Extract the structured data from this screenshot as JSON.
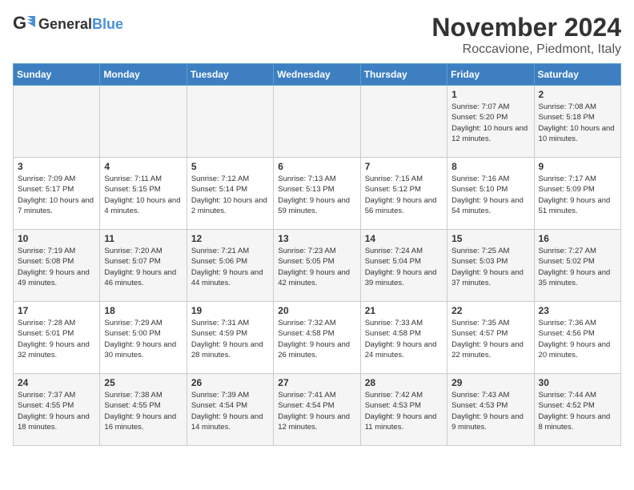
{
  "logo": {
    "text_general": "General",
    "text_blue": "Blue"
  },
  "calendar": {
    "title": "November 2024",
    "subtitle": "Roccavione, Piedmont, Italy"
  },
  "days_of_week": [
    "Sunday",
    "Monday",
    "Tuesday",
    "Wednesday",
    "Thursday",
    "Friday",
    "Saturday"
  ],
  "weeks": [
    [
      {
        "day": "",
        "info": ""
      },
      {
        "day": "",
        "info": ""
      },
      {
        "day": "",
        "info": ""
      },
      {
        "day": "",
        "info": ""
      },
      {
        "day": "",
        "info": ""
      },
      {
        "day": "1",
        "info": "Sunrise: 7:07 AM\nSunset: 5:20 PM\nDaylight: 10 hours and 12 minutes."
      },
      {
        "day": "2",
        "info": "Sunrise: 7:08 AM\nSunset: 5:18 PM\nDaylight: 10 hours and 10 minutes."
      }
    ],
    [
      {
        "day": "3",
        "info": "Sunrise: 7:09 AM\nSunset: 5:17 PM\nDaylight: 10 hours and 7 minutes."
      },
      {
        "day": "4",
        "info": "Sunrise: 7:11 AM\nSunset: 5:15 PM\nDaylight: 10 hours and 4 minutes."
      },
      {
        "day": "5",
        "info": "Sunrise: 7:12 AM\nSunset: 5:14 PM\nDaylight: 10 hours and 2 minutes."
      },
      {
        "day": "6",
        "info": "Sunrise: 7:13 AM\nSunset: 5:13 PM\nDaylight: 9 hours and 59 minutes."
      },
      {
        "day": "7",
        "info": "Sunrise: 7:15 AM\nSunset: 5:12 PM\nDaylight: 9 hours and 56 minutes."
      },
      {
        "day": "8",
        "info": "Sunrise: 7:16 AM\nSunset: 5:10 PM\nDaylight: 9 hours and 54 minutes."
      },
      {
        "day": "9",
        "info": "Sunrise: 7:17 AM\nSunset: 5:09 PM\nDaylight: 9 hours and 51 minutes."
      }
    ],
    [
      {
        "day": "10",
        "info": "Sunrise: 7:19 AM\nSunset: 5:08 PM\nDaylight: 9 hours and 49 minutes."
      },
      {
        "day": "11",
        "info": "Sunrise: 7:20 AM\nSunset: 5:07 PM\nDaylight: 9 hours and 46 minutes."
      },
      {
        "day": "12",
        "info": "Sunrise: 7:21 AM\nSunset: 5:06 PM\nDaylight: 9 hours and 44 minutes."
      },
      {
        "day": "13",
        "info": "Sunrise: 7:23 AM\nSunset: 5:05 PM\nDaylight: 9 hours and 42 minutes."
      },
      {
        "day": "14",
        "info": "Sunrise: 7:24 AM\nSunset: 5:04 PM\nDaylight: 9 hours and 39 minutes."
      },
      {
        "day": "15",
        "info": "Sunrise: 7:25 AM\nSunset: 5:03 PM\nDaylight: 9 hours and 37 minutes."
      },
      {
        "day": "16",
        "info": "Sunrise: 7:27 AM\nSunset: 5:02 PM\nDaylight: 9 hours and 35 minutes."
      }
    ],
    [
      {
        "day": "17",
        "info": "Sunrise: 7:28 AM\nSunset: 5:01 PM\nDaylight: 9 hours and 32 minutes."
      },
      {
        "day": "18",
        "info": "Sunrise: 7:29 AM\nSunset: 5:00 PM\nDaylight: 9 hours and 30 minutes."
      },
      {
        "day": "19",
        "info": "Sunrise: 7:31 AM\nSunset: 4:59 PM\nDaylight: 9 hours and 28 minutes."
      },
      {
        "day": "20",
        "info": "Sunrise: 7:32 AM\nSunset: 4:58 PM\nDaylight: 9 hours and 26 minutes."
      },
      {
        "day": "21",
        "info": "Sunrise: 7:33 AM\nSunset: 4:58 PM\nDaylight: 9 hours and 24 minutes."
      },
      {
        "day": "22",
        "info": "Sunrise: 7:35 AM\nSunset: 4:57 PM\nDaylight: 9 hours and 22 minutes."
      },
      {
        "day": "23",
        "info": "Sunrise: 7:36 AM\nSunset: 4:56 PM\nDaylight: 9 hours and 20 minutes."
      }
    ],
    [
      {
        "day": "24",
        "info": "Sunrise: 7:37 AM\nSunset: 4:55 PM\nDaylight: 9 hours and 18 minutes."
      },
      {
        "day": "25",
        "info": "Sunrise: 7:38 AM\nSunset: 4:55 PM\nDaylight: 9 hours and 16 minutes."
      },
      {
        "day": "26",
        "info": "Sunrise: 7:39 AM\nSunset: 4:54 PM\nDaylight: 9 hours and 14 minutes."
      },
      {
        "day": "27",
        "info": "Sunrise: 7:41 AM\nSunset: 4:54 PM\nDaylight: 9 hours and 12 minutes."
      },
      {
        "day": "28",
        "info": "Sunrise: 7:42 AM\nSunset: 4:53 PM\nDaylight: 9 hours and 11 minutes."
      },
      {
        "day": "29",
        "info": "Sunrise: 7:43 AM\nSunset: 4:53 PM\nDaylight: 9 hours and 9 minutes."
      },
      {
        "day": "30",
        "info": "Sunrise: 7:44 AM\nSunset: 4:52 PM\nDaylight: 9 hours and 8 minutes."
      }
    ]
  ]
}
